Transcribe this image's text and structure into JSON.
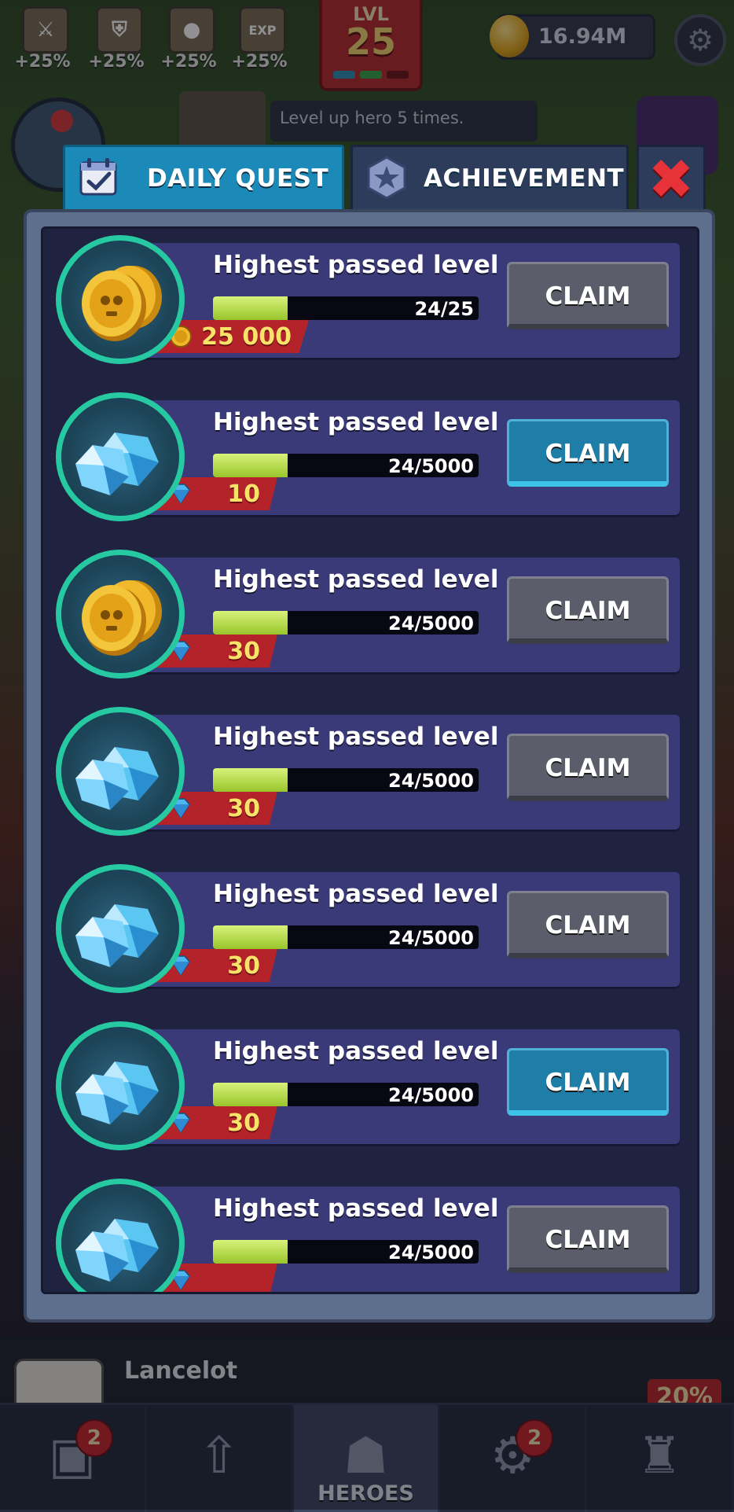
{
  "top_bar": {
    "boosts": [
      {
        "icon": "sword-icon",
        "value": "+25%"
      },
      {
        "icon": "shield-icon",
        "value": "+25%"
      },
      {
        "icon": "coin-icon",
        "value": "+25%"
      },
      {
        "icon": "exp-icon",
        "value": "+25%"
      }
    ],
    "level_label": "LVL",
    "level_value": "25",
    "coins": "16.94M",
    "hint_text": "Level up hero 5 times."
  },
  "modal": {
    "tabs": [
      {
        "label": "DAILY QUEST",
        "icon": "calendar-check-icon",
        "active": true
      },
      {
        "label": "ACHIEVEMENT",
        "icon": "star-badge-icon",
        "active": false
      }
    ],
    "close_icon": "close-icon",
    "quests": [
      {
        "title": "Highest passed level",
        "progress": "24/25",
        "fill_fraction": 0.28,
        "reward_icon": "gold-coin-icon",
        "ring_icon": "gold-coins-icon",
        "reward_value": "25 000",
        "button": "CLAIM",
        "claimable": false
      },
      {
        "title": "Highest passed level",
        "progress": "24/5000",
        "fill_fraction": 0.28,
        "reward_icon": "gem-icon",
        "ring_icon": "gems-icon",
        "reward_value": "10",
        "button": "CLAIM",
        "claimable": true
      },
      {
        "title": "Highest passed level",
        "progress": "24/5000",
        "fill_fraction": 0.28,
        "reward_icon": "gem-icon",
        "ring_icon": "gold-coins-icon",
        "reward_value": "30",
        "button": "CLAIM",
        "claimable": false
      },
      {
        "title": "Highest passed level",
        "progress": "24/5000",
        "fill_fraction": 0.28,
        "reward_icon": "gem-icon",
        "ring_icon": "gems-icon",
        "reward_value": "30",
        "button": "CLAIM",
        "claimable": false
      },
      {
        "title": "Highest passed level",
        "progress": "24/5000",
        "fill_fraction": 0.28,
        "reward_icon": "gem-icon",
        "ring_icon": "gems-icon",
        "reward_value": "30",
        "button": "CLAIM",
        "claimable": false
      },
      {
        "title": "Highest passed level",
        "progress": "24/5000",
        "fill_fraction": 0.28,
        "reward_icon": "gem-icon",
        "ring_icon": "gems-icon",
        "reward_value": "30",
        "button": "CLAIM",
        "claimable": true
      },
      {
        "title": "Highest passed level",
        "progress": "24/5000",
        "fill_fraction": 0.28,
        "reward_icon": "gem-icon",
        "ring_icon": "gems-icon",
        "reward_value": "",
        "button": "CLAIM",
        "claimable": false
      }
    ]
  },
  "hero_strip": {
    "hero_name": "Lancelot",
    "percent": "20%"
  },
  "bottom_nav": {
    "items": [
      {
        "icon": "chest-icon",
        "label": "",
        "badge": "2",
        "active": false
      },
      {
        "icon": "upgrade-book-icon",
        "label": "",
        "badge": "",
        "active": false
      },
      {
        "icon": "helmet-icon",
        "label": "HEROES",
        "badge": "",
        "active": true
      },
      {
        "icon": "gear-icon",
        "label": "",
        "badge": "2",
        "active": false
      },
      {
        "icon": "castle-icon",
        "label": "",
        "badge": "",
        "active": false
      }
    ]
  },
  "colors": {
    "accent_tab": "#1c8ab8",
    "claim_active": "#1f7ea8",
    "claim_inactive": "#5b5d6a",
    "ring": "#26c9a1",
    "progress_fill": "#a6d135",
    "reward_ribbon": "#b5232a"
  }
}
